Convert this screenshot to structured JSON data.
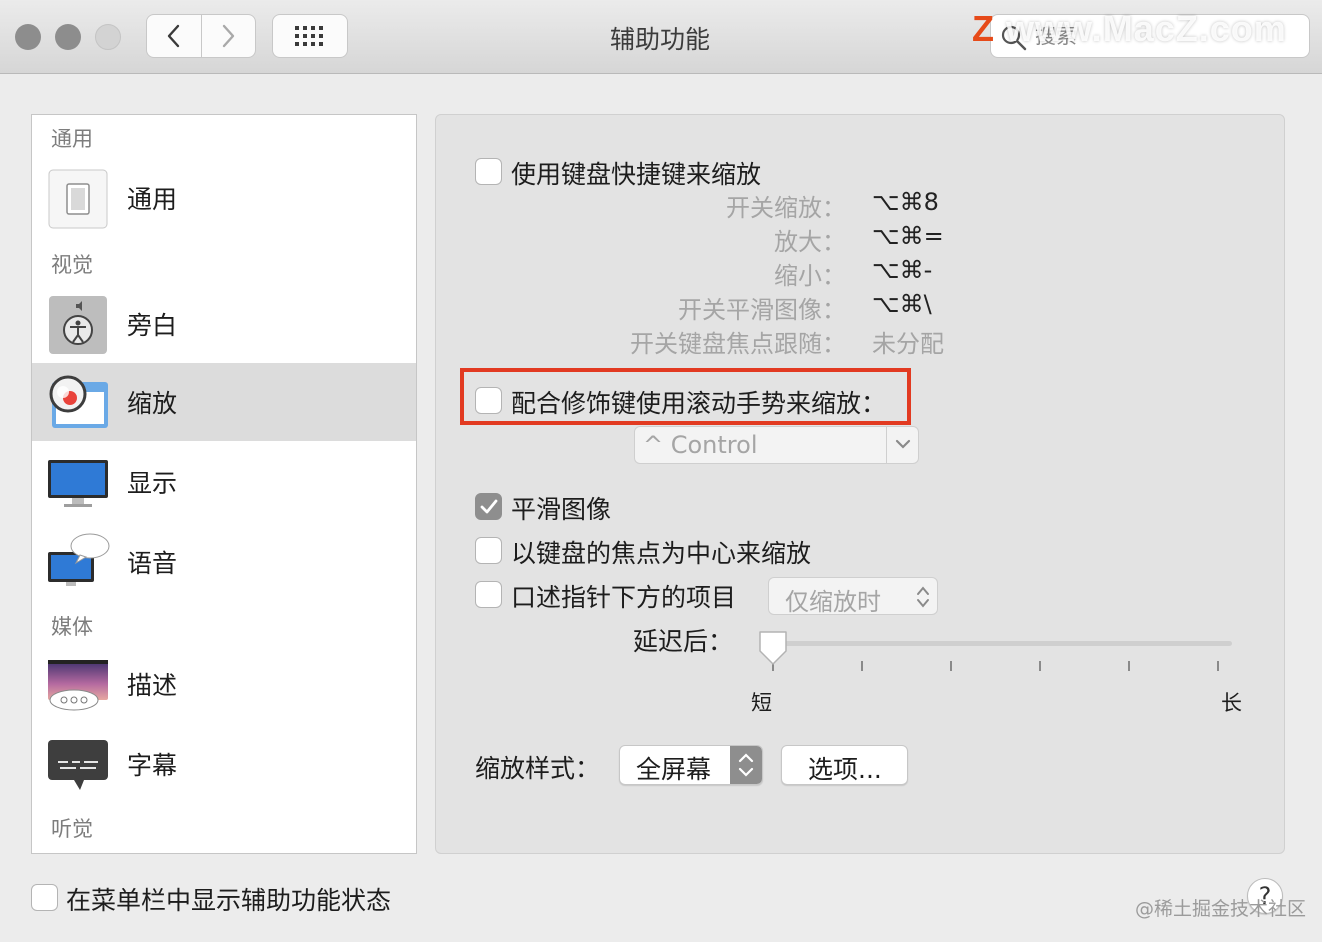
{
  "window": {
    "title": "辅助功能",
    "search_placeholder": "搜索",
    "watermark_text": "www.MacZ.com",
    "watermark_z": "Z"
  },
  "sidebar": {
    "sections": [
      {
        "header": "通用",
        "items": [
          {
            "label": "通用",
            "icon": "switch-icon"
          }
        ]
      },
      {
        "header": "视觉",
        "items": [
          {
            "label": "旁白",
            "icon": "voiceover-icon"
          },
          {
            "label": "缩放",
            "icon": "zoom-icon",
            "selected": true
          },
          {
            "label": "显示",
            "icon": "display-icon"
          },
          {
            "label": "语音",
            "icon": "speech-icon"
          }
        ]
      },
      {
        "header": "媒体",
        "items": [
          {
            "label": "描述",
            "icon": "descriptions-icon"
          },
          {
            "label": "字幕",
            "icon": "captions-icon"
          }
        ]
      },
      {
        "header": "听觉",
        "items": []
      }
    ]
  },
  "zoom": {
    "keyboard_shortcuts": {
      "label": "使用键盘快捷键来缩放",
      "checked": false,
      "rows": [
        {
          "key": "开关缩放：",
          "value": "⌥⌘8"
        },
        {
          "key": "放大：",
          "value": "⌥⌘="
        },
        {
          "key": "缩小：",
          "value": "⌥⌘-"
        },
        {
          "key": "开关平滑图像：",
          "value": "⌥⌘\\"
        },
        {
          "key": "开关键盘焦点跟随：",
          "value": "未分配"
        }
      ]
    },
    "scroll_gesture": {
      "label": "配合修饰键使用滚动手势来缩放：",
      "checked": false,
      "modifier": "^ Control",
      "highlight_color": "#e23a21"
    },
    "smooth_images": {
      "label": "平滑图像",
      "checked": true
    },
    "follow_focus": {
      "label": "以键盘的焦点为中心来缩放",
      "checked": false
    },
    "speak_items": {
      "label": "口述指针下方的项目",
      "checked": false,
      "mode": "仅缩放时"
    },
    "delay": {
      "label": "延迟后：",
      "min_label": "短",
      "max_label": "长",
      "value_fraction": 0.0
    },
    "style": {
      "label": "缩放样式：",
      "value": "全屏幕",
      "options_button": "选项..."
    }
  },
  "footer": {
    "menu_bar_status": {
      "label": "在菜单栏中显示辅助功能状态",
      "checked": false
    },
    "help": "?",
    "credit": "@稀土掘金技术社区"
  }
}
